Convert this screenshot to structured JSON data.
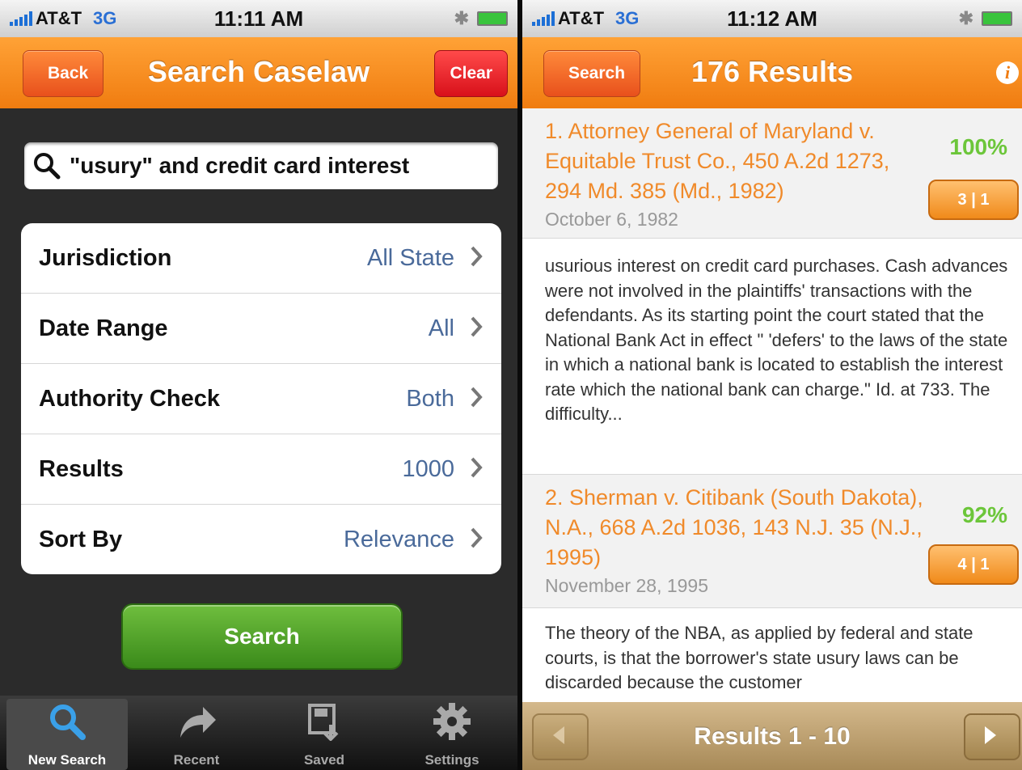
{
  "left": {
    "status": {
      "carrier": "AT&T",
      "network": "3G",
      "time": "11:11 AM"
    },
    "nav": {
      "back_label": "Back",
      "title": "Search Caselaw",
      "clear_label": "Clear"
    },
    "search": {
      "query": "\"usury\" and credit card interest"
    },
    "options": [
      {
        "label": "Jurisdiction",
        "value": "All State"
      },
      {
        "label": "Date Range",
        "value": "All"
      },
      {
        "label": "Authority Check",
        "value": "Both"
      },
      {
        "label": "Results",
        "value": "1000"
      },
      {
        "label": "Sort By",
        "value": "Relevance"
      }
    ],
    "search_button": "Search",
    "tabs": [
      {
        "label": "New Search",
        "icon": "search-icon"
      },
      {
        "label": "Recent",
        "icon": "back-arrow-icon"
      },
      {
        "label": "Saved",
        "icon": "save-icon"
      },
      {
        "label": "Settings",
        "icon": "gear-icon"
      }
    ]
  },
  "right": {
    "status": {
      "carrier": "AT&T",
      "network": "3G",
      "time": "11:12 AM"
    },
    "nav": {
      "back_label": "Search",
      "title": "176 Results",
      "info_icon": "info-icon"
    },
    "results": [
      {
        "title": "1.  Attorney General of Maryland v. Equitable Trust Co., 450 A.2d 1273, 294 Md. 385 (Md., 1982)",
        "date": "October 6, 1982",
        "relevance": "100%",
        "cites": "3 | 1",
        "snippet": "usurious interest on credit card purchases. Cash advances were not involved in the plaintiffs' transactions with the defendants.   As its starting point the court stated that the National Bank Act in effect \" 'defers' to the laws of the state in which a national bank is located to establish the interest rate which the national bank can charge.\"  Id. at 733.   The difficulty..."
      },
      {
        "title": "2.  Sherman v. Citibank (South Dakota), N.A., 668 A.2d 1036, 143 N.J. 35 (N.J., 1995)",
        "date": "November 28, 1995",
        "relevance": "92%",
        "cites": "4 | 1",
        "snippet": "The theory of the NBA, as applied by federal and state courts, is that the borrower's state usury laws can be discarded because the customer"
      }
    ],
    "pager": {
      "label": "Results 1 - 10"
    }
  }
}
